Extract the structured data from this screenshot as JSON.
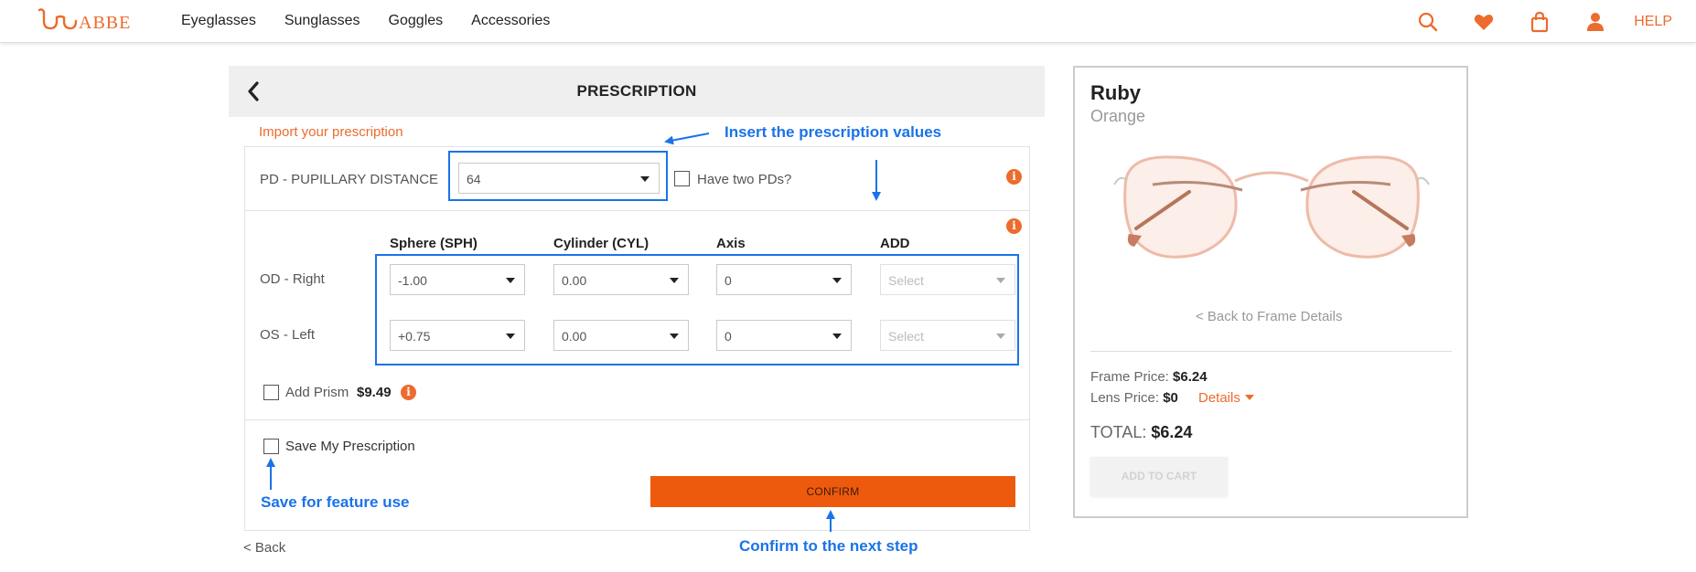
{
  "header": {
    "logo_text": "ABBE",
    "nav": [
      "Eyeglasses",
      "Sunglasses",
      "Goggles",
      "Accessories"
    ],
    "icons": [
      "search-icon",
      "heart-icon",
      "bag-icon",
      "user-icon"
    ],
    "help": "HELP"
  },
  "colors": {
    "accent": "#ec6b2d",
    "confirm_bg": "#ee5a0d",
    "annotation": "#1a73e8"
  },
  "rx": {
    "title": "PRESCRIPTION",
    "import_link": "Import your prescription",
    "pd_label": "PD - PUPILLARY DISTANCE",
    "pd_value": "64",
    "two_pd_label": "Have two PDs?",
    "columns": [
      "Sphere (SPH)",
      "Cylinder (CYL)",
      "Axis",
      "ADD"
    ],
    "rows": [
      {
        "label": "OD - Right",
        "sph": "-1.00",
        "cyl": "0.00",
        "axis": "0",
        "add": "Select"
      },
      {
        "label": "OS - Left",
        "sph": "+0.75",
        "cyl": "0.00",
        "axis": "0",
        "add": "Select"
      }
    ],
    "prism_label": "Add Prism",
    "prism_price": "$9.49",
    "save_label": "Save My Prescription",
    "confirm": "CONFIRM",
    "back": "< Back"
  },
  "annotations": {
    "insert": "Insert the prescription values",
    "save": "Save for feature use",
    "confirm": "Confirm to the next step"
  },
  "product": {
    "name": "Ruby",
    "color": "Orange",
    "back_link": "< Back to Frame Details",
    "frame_price_label": "Frame Price:",
    "frame_price": "$6.24",
    "lens_price_label": "Lens Price:",
    "lens_price": "$0",
    "details": "Details",
    "total_label": "TOTAL:",
    "total": "$6.24",
    "add_to_cart": "ADD TO CART"
  }
}
